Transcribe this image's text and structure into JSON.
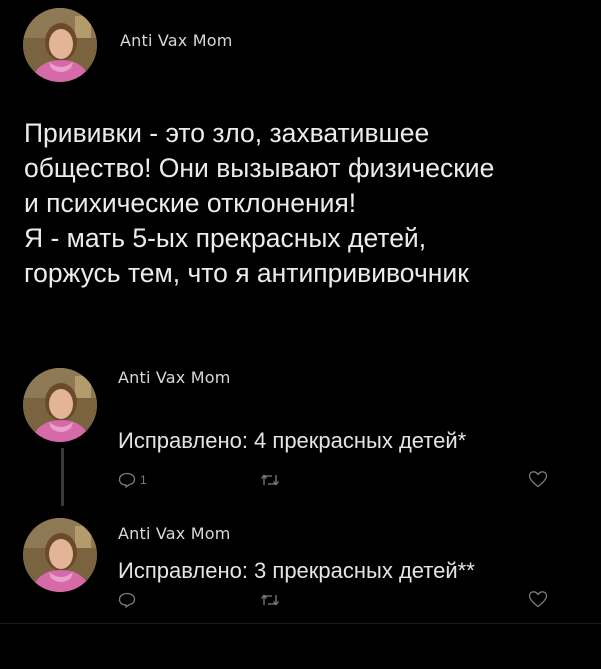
{
  "post": {
    "author": "Anti Vax Mom",
    "avatar_icon": "woman-portrait-icon",
    "lines": [
      "Прививки - это зло, захватившее",
      "общество! Они вызывают физические",
      "и психические отклонения!",
      "Я - мать 5-ых прекрасных детей,",
      "горжусь тем, что я антипрививочник"
    ]
  },
  "replies": [
    {
      "author": "Anti Vax Mom",
      "text": "Исправлено: 4 прекрасных детей*",
      "reply_count": "1",
      "actions": [
        "comment-icon",
        "retweet-icon",
        "heart-icon"
      ]
    },
    {
      "author": "Anti Vax Mom",
      "text": "Исправлено: 3 прекрасных детей**",
      "reply_count": "",
      "actions": [
        "comment-icon",
        "retweet-icon",
        "heart-icon"
      ]
    }
  ],
  "colors": {
    "background": "#000000",
    "text": "#ececec",
    "icon": "#7c7c7c"
  }
}
